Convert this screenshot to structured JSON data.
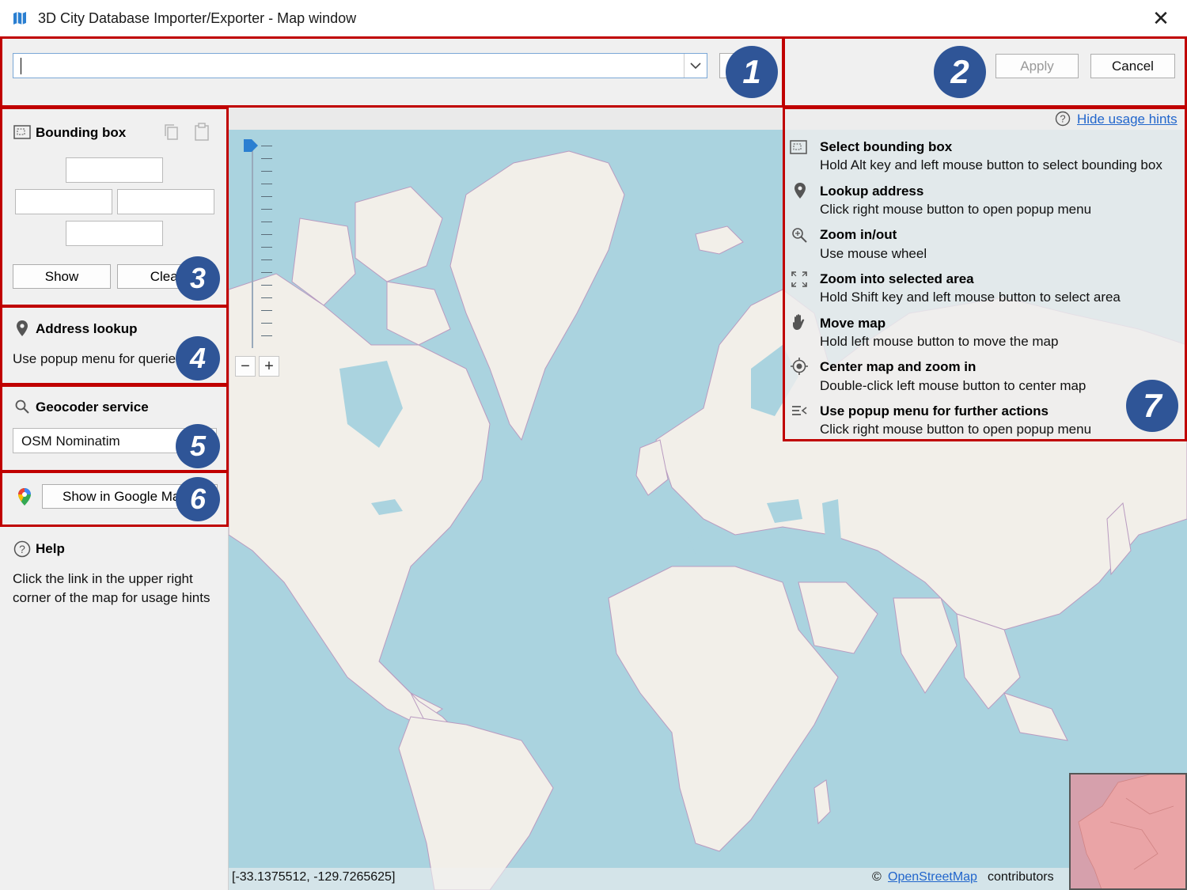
{
  "window": {
    "title": "3D City Database Importer/Exporter - Map window",
    "close_glyph": "✕"
  },
  "toolbar": {
    "search_value": "",
    "apply_label": "Apply",
    "cancel_label": "Cancel"
  },
  "bbox": {
    "title": "Bounding box",
    "show_label": "Show",
    "clear_label": "Clear",
    "north": "",
    "west": "",
    "east": "",
    "south": ""
  },
  "address": {
    "title": "Address lookup",
    "text": "Use popup menu for queries"
  },
  "geocoder": {
    "title": "Geocoder service",
    "selected": "OSM Nominatim"
  },
  "google": {
    "button_label": "Show in Google Maps"
  },
  "help": {
    "title": "Help",
    "line1": "Click the link in the upper right",
    "line2": "corner of the map for usage hints"
  },
  "hints": {
    "hide_link": "Hide usage hints",
    "items": [
      {
        "title": "Select bounding box",
        "desc": "Hold Alt key and left mouse button to select bounding box",
        "icon": "bounding-box-icon"
      },
      {
        "title": "Lookup address",
        "desc": "Click right mouse button to open popup menu",
        "icon": "map-pin-icon"
      },
      {
        "title": "Zoom in/out",
        "desc": "Use mouse wheel",
        "icon": "zoom-icon"
      },
      {
        "title": "Zoom into selected area",
        "desc": "Hold Shift key and left mouse button to select area",
        "icon": "expand-icon"
      },
      {
        "title": "Move map",
        "desc": "Hold left mouse button to move the map",
        "icon": "hand-icon"
      },
      {
        "title": "Center map and zoom in",
        "desc": "Double-click left mouse button to center map",
        "icon": "target-icon"
      },
      {
        "title": "Use popup menu for further actions",
        "desc": "Click right mouse button to open popup menu",
        "icon": "menu-icon"
      }
    ]
  },
  "map": {
    "zoom_minus": "−",
    "zoom_plus": "+",
    "coordinates": "[-33.1375512,  -129.7265625]",
    "attribution_prefix": "©",
    "attribution_link": "OpenStreetMap",
    "attribution_suffix": "contributors"
  },
  "badges": [
    "1",
    "2",
    "3",
    "4",
    "5",
    "6",
    "7"
  ],
  "colors": {
    "badge": "#2f5597",
    "highlight_box": "#c00000",
    "water": "#aad3df",
    "land": "#f2efe9",
    "link": "#2266cc"
  }
}
